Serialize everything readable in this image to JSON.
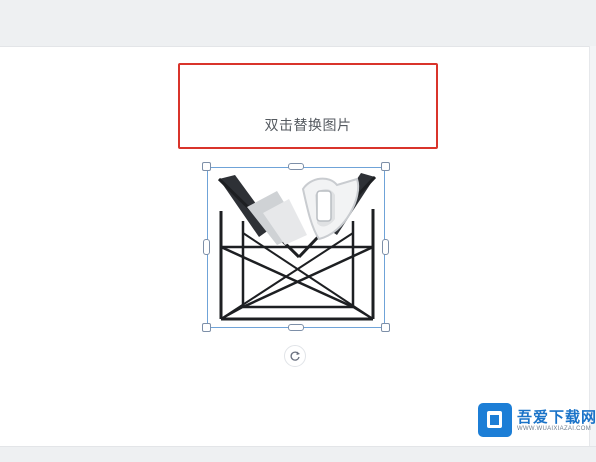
{
  "placeholder": {
    "label": "双击替换图片"
  },
  "selected_image": {
    "description_icon": "magazine-rack-icon",
    "handles": [
      "top-left",
      "top",
      "top-right",
      "left",
      "right",
      "bottom-left",
      "bottom",
      "bottom-right"
    ],
    "rotate_icon": "rotate-icon"
  },
  "watermark": {
    "name": "吾爱下载网",
    "url": "WWW.WUAIXIAZAI.COM"
  },
  "colors": {
    "placeholder_border": "#d9342b",
    "selection_line": "#6fa3d8",
    "handle_border": "#7d8fa8",
    "watermark_blue": "#1c7ed6",
    "top_bar": "#eef0f2"
  }
}
